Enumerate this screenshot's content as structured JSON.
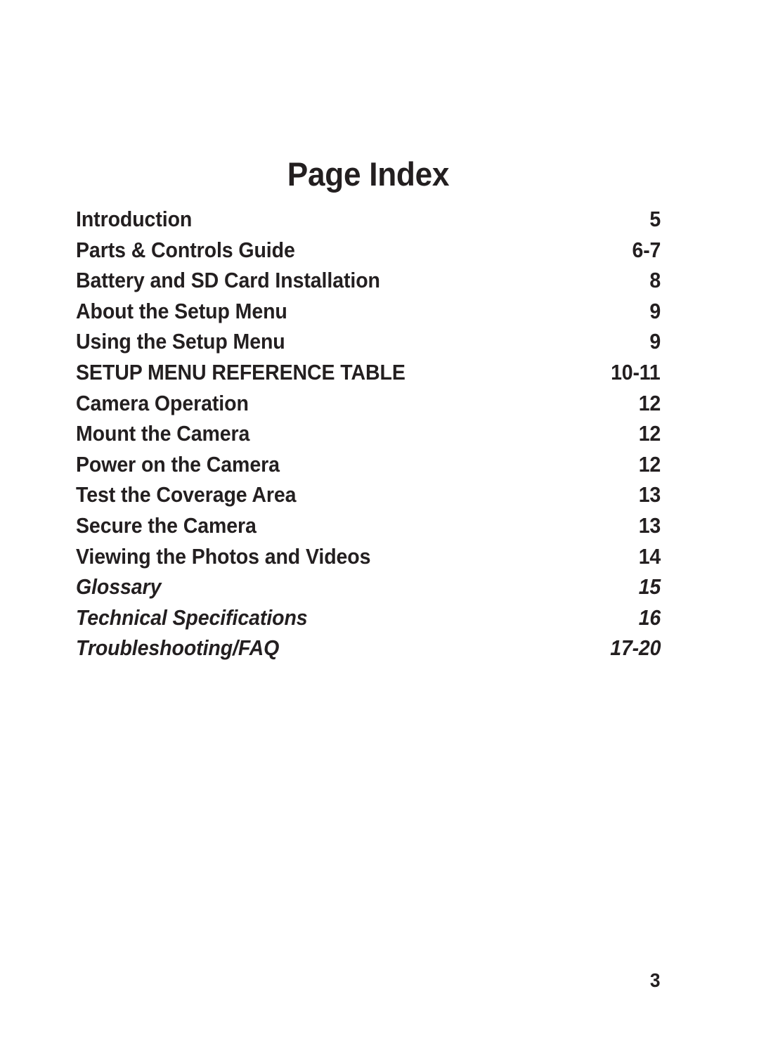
{
  "document": {
    "title": "Page Index",
    "footer_page_number": "3",
    "text_color": "#231f20",
    "background_color": "#ffffff"
  },
  "index": {
    "entries": [
      {
        "label": "Introduction",
        "page": "5",
        "style": "bold"
      },
      {
        "label": "Parts & Controls Guide",
        "page": "6-7",
        "style": "bold"
      },
      {
        "label": "Battery and SD Card Installation",
        "page": "8",
        "style": "bold"
      },
      {
        "label": "About the Setup Menu",
        "page": "9",
        "style": "bold"
      },
      {
        "label": "Using the Setup Menu",
        "page": "9",
        "style": "bold"
      },
      {
        "label": "SETUP MENU REFERENCE TABLE",
        "page": "10-11",
        "style": "bold"
      },
      {
        "label": "Camera Operation",
        "page": "12",
        "style": "bold"
      },
      {
        "label": "Mount the Camera",
        "page": "12",
        "style": "bold"
      },
      {
        "label": "Power on the Camera",
        "page": "12",
        "style": "bold"
      },
      {
        "label": "Test the Coverage Area",
        "page": "13",
        "style": "bold"
      },
      {
        "label": "Secure the Camera",
        "page": "13",
        "style": "bold"
      },
      {
        "label": "Viewing the Photos and Videos",
        "page": "14",
        "style": "bold"
      },
      {
        "label": "Glossary",
        "page": "15",
        "style": "bold-italic"
      },
      {
        "label": "Technical Specifications",
        "page": "16",
        "style": "bold-italic"
      },
      {
        "label": "Troubleshooting/FAQ",
        "page": "17-20",
        "style": "bold-italic"
      }
    ]
  }
}
